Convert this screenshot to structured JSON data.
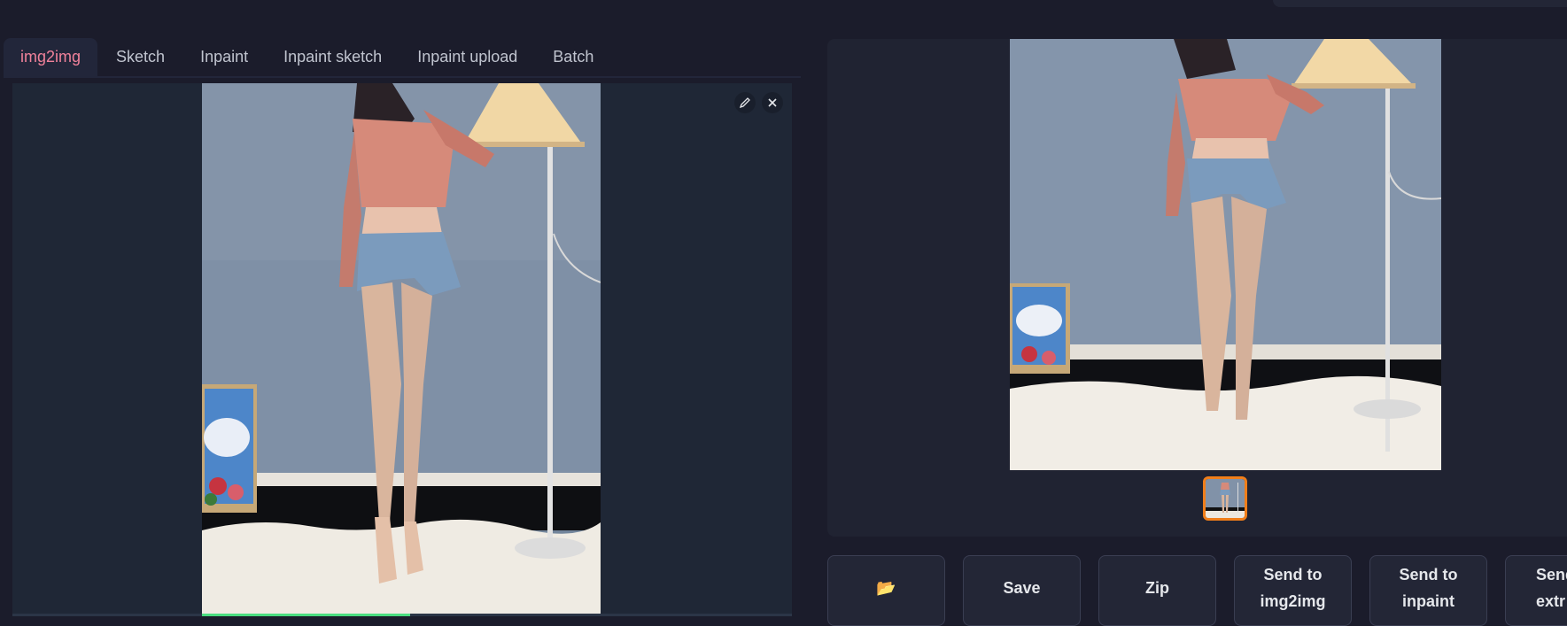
{
  "app": {
    "tabs": [
      {
        "label": "img2img",
        "active": true
      },
      {
        "label": "Sketch",
        "active": false
      },
      {
        "label": "Inpaint",
        "active": false
      },
      {
        "label": "Inpaint sketch",
        "active": false
      },
      {
        "label": "Inpaint upload",
        "active": false
      },
      {
        "label": "Batch",
        "active": false
      }
    ],
    "accent_color": "#f0819a",
    "selected_thumb_color": "#f07e1a"
  },
  "editor": {
    "icons": [
      "pencil-icon",
      "close-icon"
    ]
  },
  "gallery": {
    "thumbnail_count": 1,
    "selected_index": 0
  },
  "actions": {
    "folder_icon": "📂",
    "save_label": "Save",
    "zip_label": "Zip",
    "send_img2img_label": "Send to\nimg2img",
    "send_inpaint_label": "Send to\ninpaint",
    "send_extras_label": "Send\nextr"
  }
}
